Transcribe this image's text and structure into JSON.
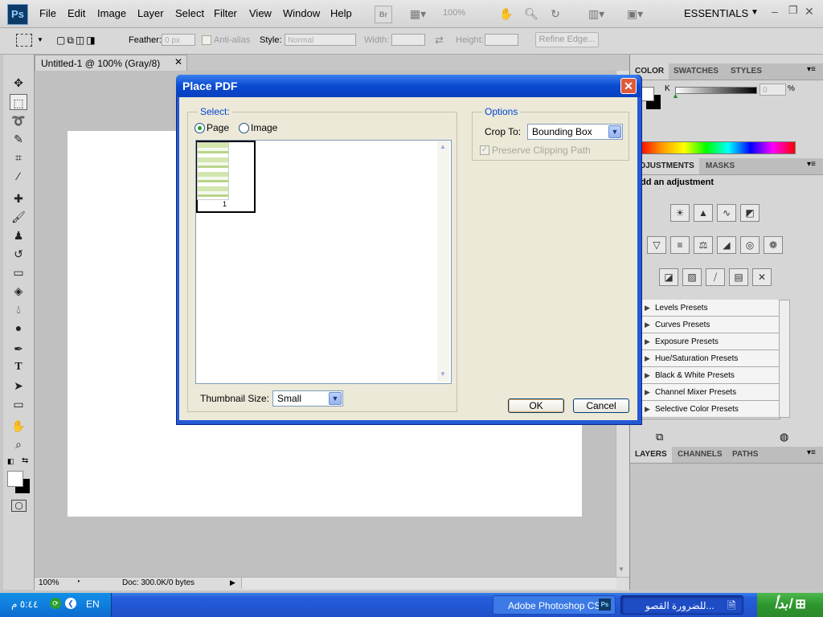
{
  "menubar": {
    "logo": "Ps",
    "items": [
      "File",
      "Edit",
      "Image",
      "Layer",
      "Select",
      "Filter",
      "View",
      "Window",
      "Help"
    ],
    "zoom": "100%",
    "workspace": "ESSENTIALS"
  },
  "options": {
    "feather_label": "Feather:",
    "feather_value": "0 px",
    "antialias_label": "Anti-alias",
    "style_label": "Style:",
    "style_value": "Normal",
    "width_label": "Width:",
    "height_label": "Height:",
    "refine_edge": "Refine Edge..."
  },
  "document": {
    "tab_title": "Untitled-1 @ 100% (Gray/8)",
    "zoom": "100%",
    "doc_info": "Doc: 300.0K/0 bytes"
  },
  "panels": {
    "color_tabs": [
      "COLOR",
      "SWATCHES",
      "STYLES"
    ],
    "color_channel": "K",
    "color_value": "0",
    "color_unit": "%",
    "adjust_tabs": [
      "DJUSTMENTS",
      "MASKS"
    ],
    "adjust_heading": "dd an adjustment",
    "presets": [
      "Levels Presets",
      "Curves Presets",
      "Exposure Presets",
      "Hue/Saturation Presets",
      "Black & White Presets",
      "Channel Mixer Presets",
      "Selective Color Presets"
    ],
    "layer_tabs": [
      "LAYERS",
      "CHANNELS",
      "PATHS"
    ]
  },
  "dialog": {
    "title": "Place PDF",
    "select_label": "Select:",
    "radio_page": "Page",
    "radio_image": "Image",
    "thumb_number": "1",
    "thumb_size_label": "Thumbnail Size:",
    "thumb_size_value": "Small",
    "options_label": "Options",
    "crop_label": "Crop To:",
    "crop_value": "Bounding Box",
    "preserve_label": "Preserve Clipping Path",
    "ok": "OK",
    "cancel": "Cancel"
  },
  "taskbar": {
    "clock": "٥:٤٤ م",
    "lang": "EN",
    "task_photoshop": "Adobe Photoshop CS...",
    "task_other": "للضرورة القصو...",
    "start": "ابدأ"
  }
}
